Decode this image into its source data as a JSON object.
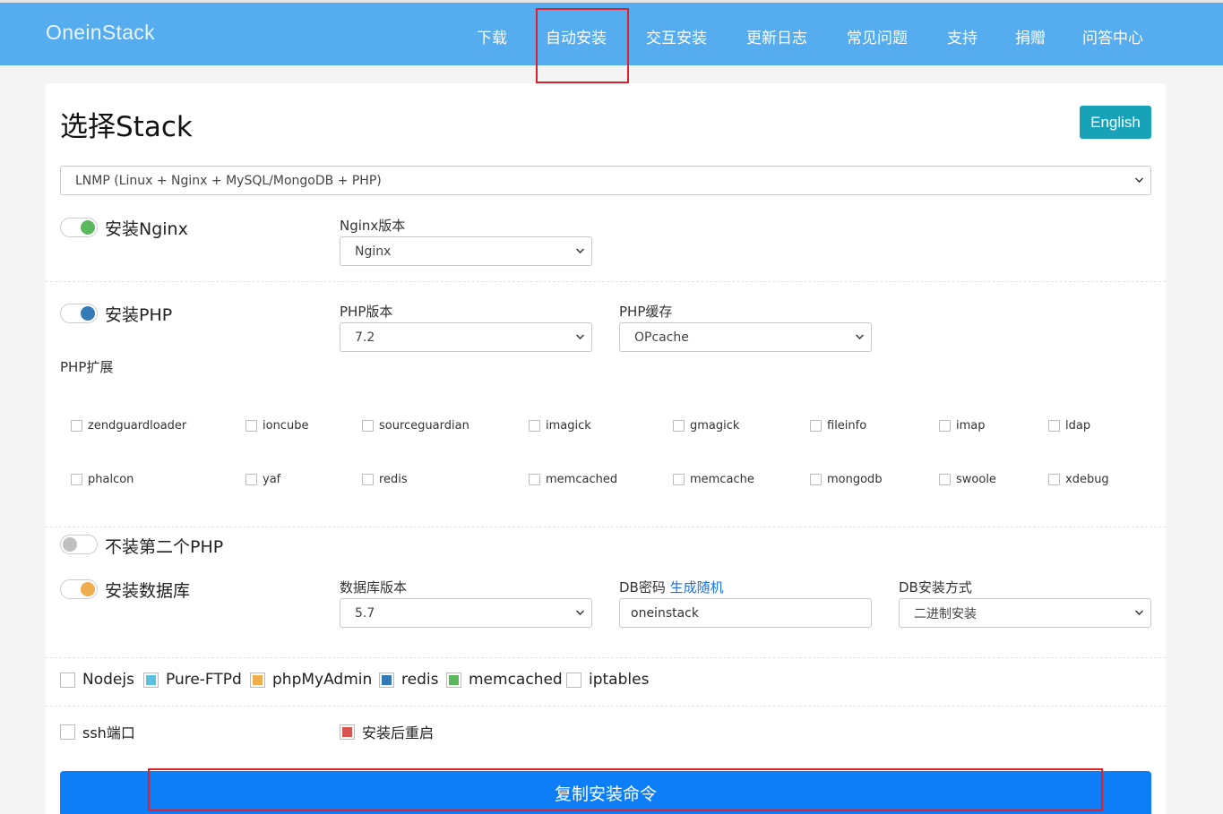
{
  "header": {
    "brand": "OneinStack",
    "nav": [
      "下载",
      "自动安装",
      "交互安装",
      "更新日志",
      "常见问题",
      "支持",
      "捐赠",
      "问答中心"
    ]
  },
  "main": {
    "title": "选择Stack",
    "lang_button": "English",
    "stack_select": "LNMP (Linux + Nginx + MySQL/MongoDB + PHP)",
    "nginx": {
      "toggle_label": "安装Nginx",
      "version_label": "Nginx版本",
      "version_value": "Nginx"
    },
    "php": {
      "toggle_label": "安装PHP",
      "version_label": "PHP版本",
      "version_value": "7.2",
      "cache_label": "PHP缓存",
      "cache_value": "OPcache",
      "ext_label": "PHP扩展",
      "extensions_row1": [
        "zendguardloader",
        "ioncube",
        "sourceguardian",
        "imagick",
        "gmagick",
        "fileinfo",
        "imap",
        "ldap"
      ],
      "extensions_row2": [
        "phalcon",
        "yaf",
        "redis",
        "memcached",
        "memcache",
        "mongodb",
        "swoole",
        "xdebug"
      ]
    },
    "php2": {
      "toggle_label": "不装第二个PHP"
    },
    "db": {
      "toggle_label": "安装数据库",
      "version_label": "数据库版本",
      "version_value": "5.7",
      "password_label": "DB密码",
      "password_link": "生成随机",
      "password_value": "oneinstack",
      "method_label": "DB安装方式",
      "method_value": "二进制安装"
    },
    "options": [
      {
        "label": "Nodejs",
        "color": ""
      },
      {
        "label": "Pure-FTPd",
        "color": "#5bc0de"
      },
      {
        "label": "phpMyAdmin",
        "color": "#f0ad4e"
      },
      {
        "label": "redis",
        "color": "#337ab7"
      },
      {
        "label": "memcached",
        "color": "#5cb85c"
      },
      {
        "label": "iptables",
        "color": ""
      }
    ],
    "ssh_label": "ssh端口",
    "reboot_label": "安装后重启",
    "reboot_color": "#d9534f",
    "copy_button": "复制安装命令"
  },
  "colors": {
    "nginx_toggle": "#5cb85c",
    "php_toggle": "#337ab7",
    "php2_toggle": "#c0c0c0",
    "db_toggle": "#f0ad4e"
  }
}
